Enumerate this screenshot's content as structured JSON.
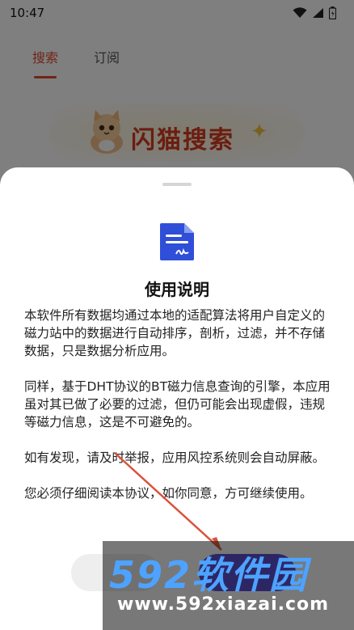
{
  "status_bar": {
    "time": "10:47",
    "icons": [
      "wifi-icon",
      "signal-icon",
      "battery-icon"
    ]
  },
  "tabs": [
    {
      "label": "搜索",
      "active": true
    },
    {
      "label": "订阅",
      "active": false
    }
  ],
  "brand": {
    "name": "闪猫搜索",
    "icons": [
      "cat-mascot-icon",
      "sparkle-icon"
    ]
  },
  "dialog": {
    "icon": "document-icon",
    "title": "使用说明",
    "paragraphs": [
      "本软件所有数据均通过本地的适配算法将用户自定义的磁力站中的数据进行自动排序，剖析，过滤，并不存储数据，只是数据分析应用。",
      "同样，基于DHT协议的BT磁力信息查询的引擎，本应用虽对其已做了必要的过滤，但仍可能会出现虚假，违规等磁力信息，这是不可避免的。",
      "如有发现，请及时举报，应用风控系统则会自动屏蔽。",
      "您必须仔细阅读本协议，如你同意，方可继续使用。"
    ]
  },
  "colors": {
    "accent": "#e24a2d",
    "brand": "#d73a1e",
    "primary_button": "#5a4bd6",
    "watermark_blue": "#4da3ff"
  },
  "watermark": {
    "logo": "592软件园",
    "url": "www.592xiazai.com"
  }
}
